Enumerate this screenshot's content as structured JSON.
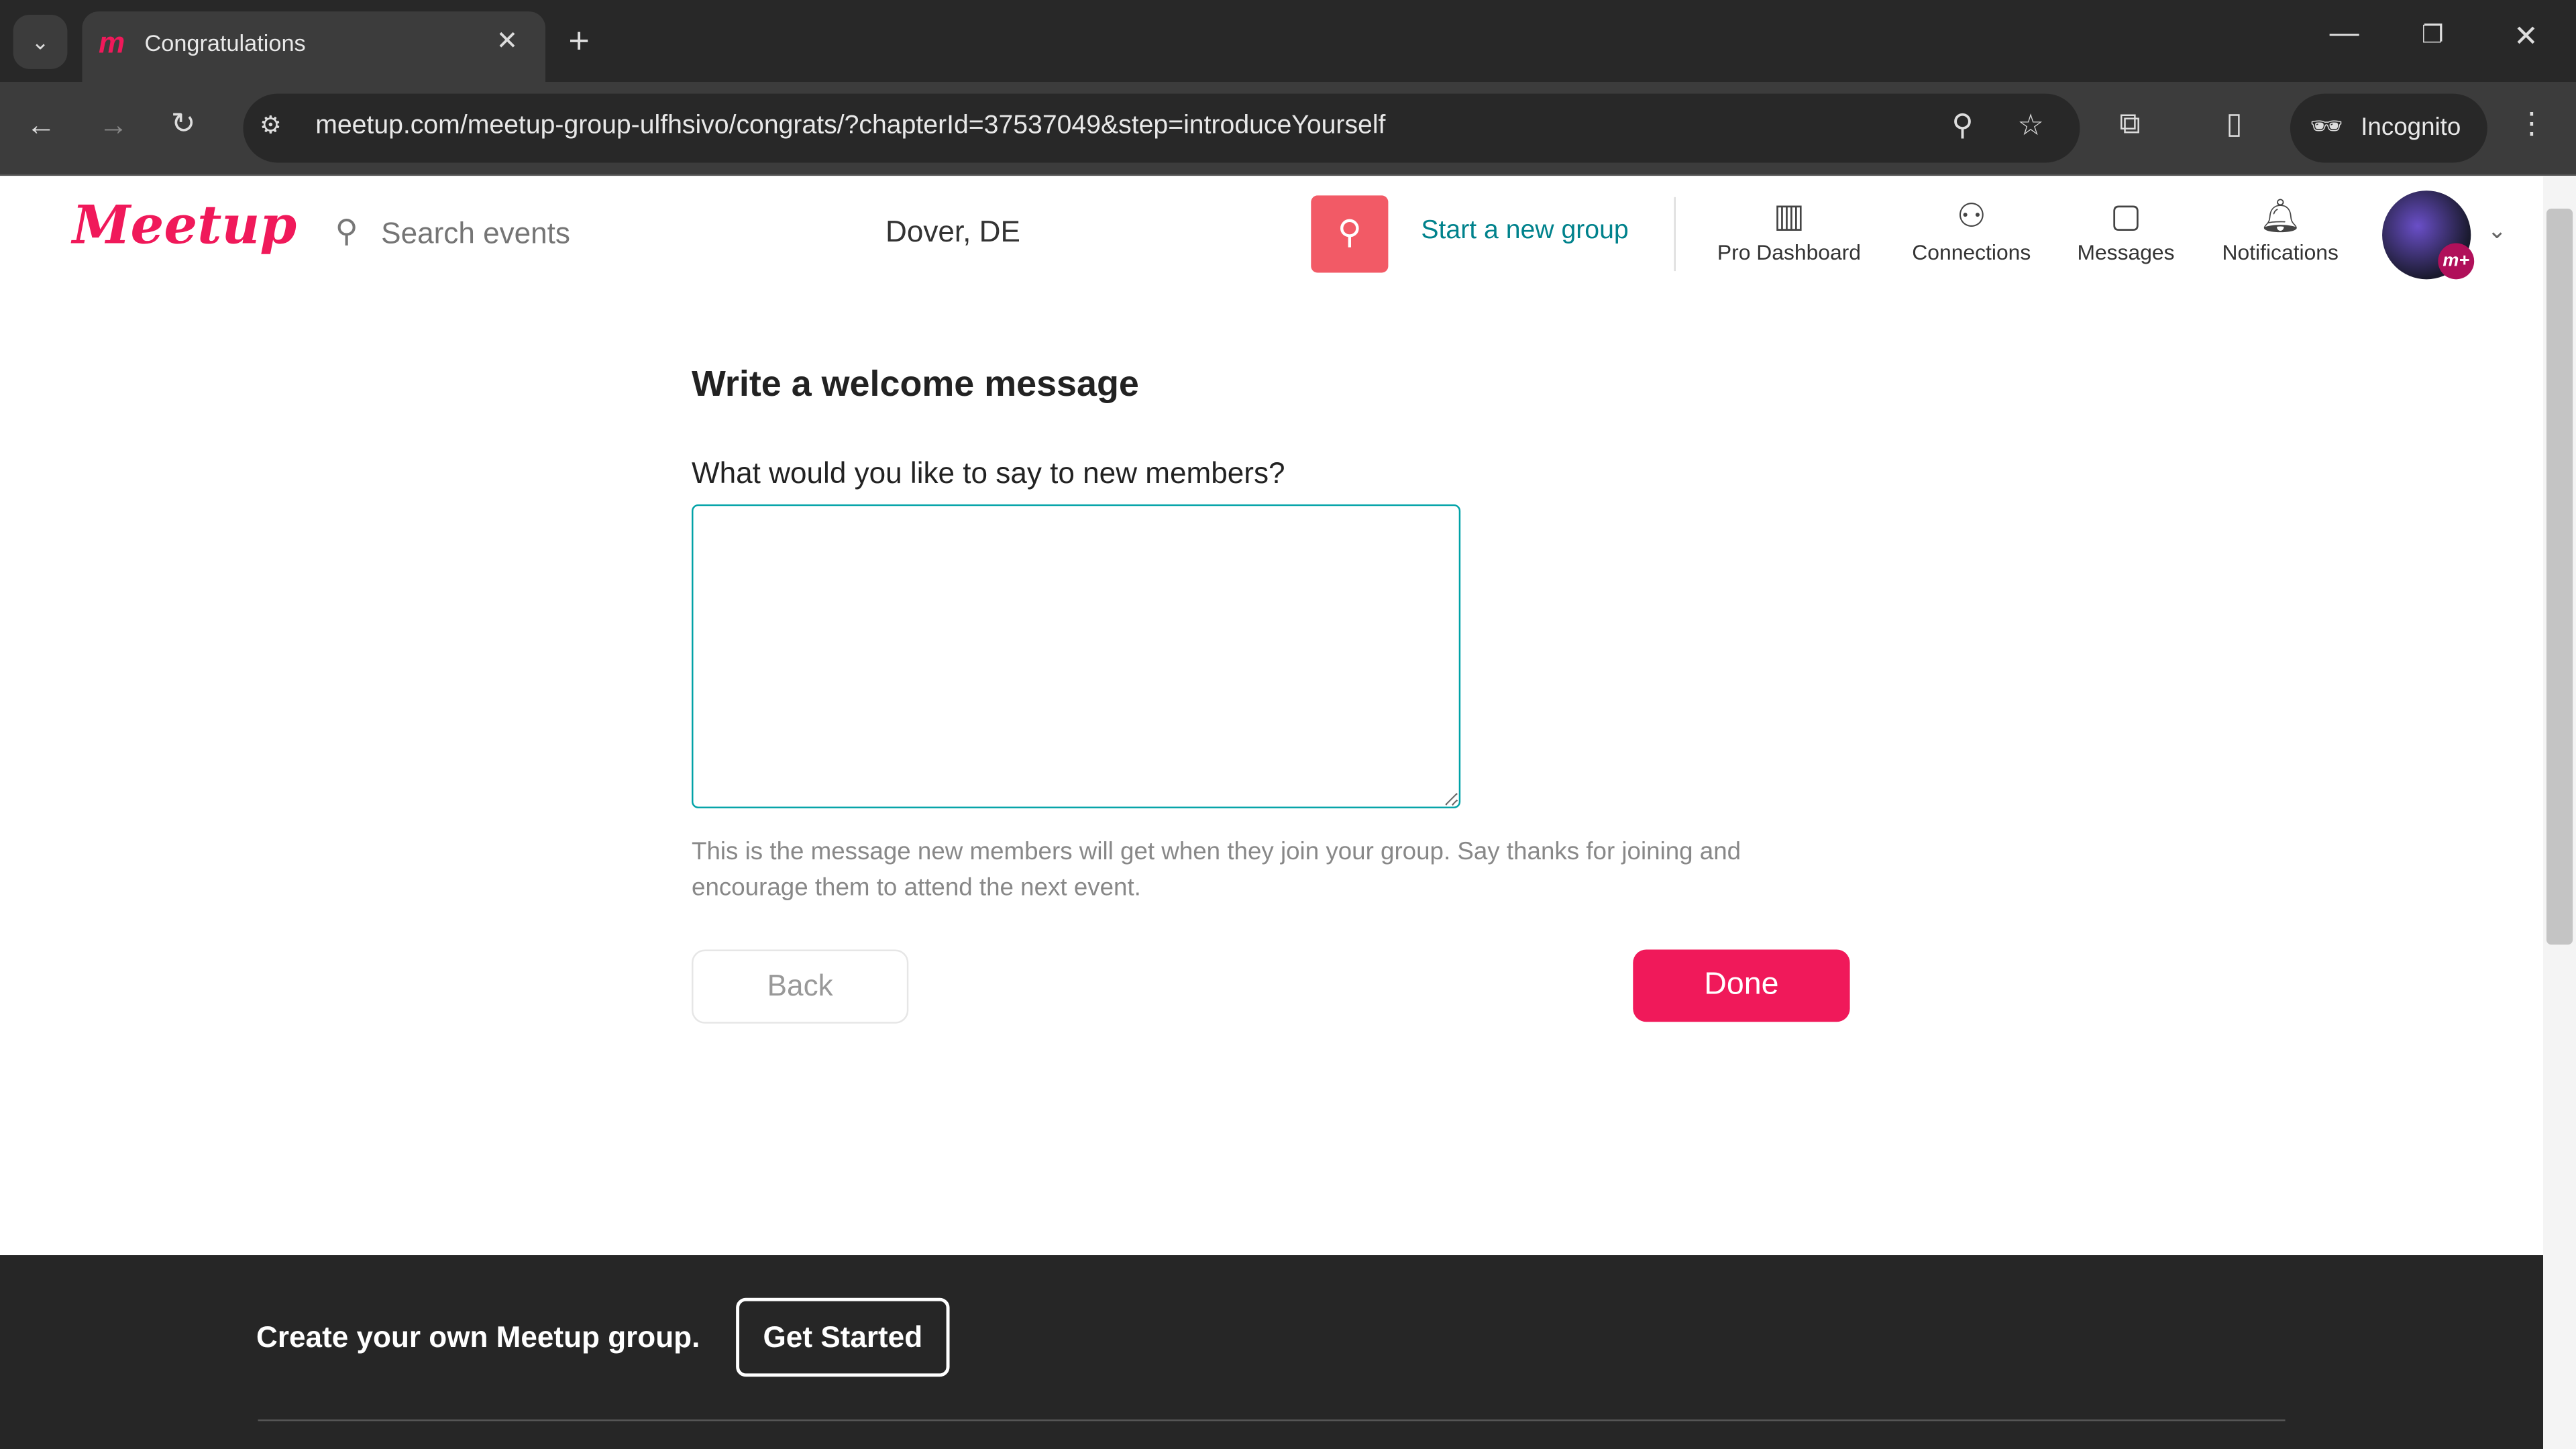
{
  "browser": {
    "tab_title": "Congratulations",
    "url": "meetup.com/meetup-group-ulfhsivo/congrats/?chapterId=37537049&step=introduceYourself",
    "incognito_label": "Incognito"
  },
  "header": {
    "logo": "Meetup",
    "search_placeholder": "Search events",
    "location": "Dover, DE",
    "start_group": "Start a new group",
    "nav": [
      {
        "label": "Pro Dashboard",
        "icon": "bar-chart-icon"
      },
      {
        "label": "Connections",
        "icon": "people-icon"
      },
      {
        "label": "Messages",
        "icon": "chat-icon"
      },
      {
        "label": "Notifications",
        "icon": "bell-icon"
      }
    ]
  },
  "main": {
    "title": "Write a welcome message",
    "question": "What would you like to say to new members?",
    "message_value": "",
    "helper": "This is the message new members will get when they join your group. Say thanks for joining and encourage them to attend the next event.",
    "back_label": "Back",
    "done_label": "Done"
  },
  "footer": {
    "cta_text": "Create your own Meetup group.",
    "get_started": "Get Started"
  },
  "colors": {
    "brand": "#f0195a",
    "accent_teal": "#00828c",
    "search_button": "#f25a66",
    "footer_bg": "#262626"
  }
}
